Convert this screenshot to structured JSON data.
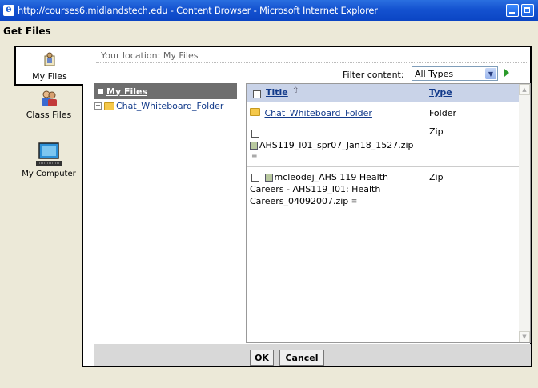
{
  "window": {
    "title": "http://courses6.midlandstech.edu - Content Browser - Microsoft Internet Explorer",
    "icon": "ie-icon"
  },
  "header": {
    "title": "Get Files"
  },
  "tabs": [
    {
      "label": "My Files",
      "icon": "user-folder-icon",
      "active": true
    },
    {
      "label": "Class Files",
      "icon": "class-users-icon",
      "active": false
    },
    {
      "label": "My Computer",
      "icon": "computer-icon",
      "active": false
    }
  ],
  "location": {
    "text": "Your location: My Files"
  },
  "filter": {
    "label": "Filter content:",
    "selected": "All Types"
  },
  "tree": {
    "root": "My Files",
    "items": [
      {
        "label": "Chat_Whiteboard_Folder"
      }
    ]
  },
  "table": {
    "columns": {
      "title": "Title",
      "type": "Type"
    },
    "rows": [
      {
        "name": "Chat_Whiteboard_Folder",
        "type": "Folder"
      },
      {
        "name": "AHS119_I01_spr07_Jan18_1527.zip",
        "type": "Zip"
      },
      {
        "name": "mcleodej_AHS 119 Health",
        "name2": "Careers - AHS119_I01: Health",
        "name3": "Careers_04092007.zip",
        "type": "Zip"
      }
    ]
  },
  "buttons": {
    "ok": "OK",
    "cancel": "Cancel"
  },
  "colors": {
    "titlebar": "#1452d0",
    "tree_header": "#6e6e6e",
    "list_header": "#c9d3e8",
    "link": "#123a8a"
  }
}
